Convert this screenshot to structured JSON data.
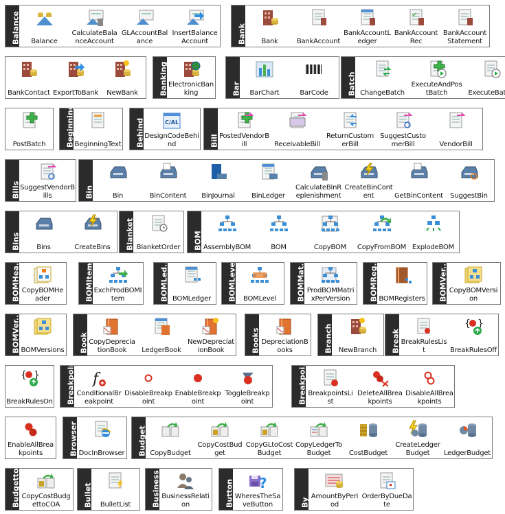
{
  "groups": [
    {
      "id": "balance",
      "header": "Balance",
      "items": [
        {
          "label": "Balance",
          "icon": "balance-scale-icon"
        },
        {
          "label": "CalculateBalanceAccount",
          "icon": "calculate-balance-icon"
        },
        {
          "label": "GLAccountBalance",
          "icon": "gl-account-balance-icon"
        },
        {
          "label": "InsertBalanceAccount",
          "icon": "insert-balance-icon"
        }
      ]
    },
    {
      "id": "bank",
      "header": "Bank",
      "items": [
        {
          "label": "Bank",
          "icon": "bank-building-icon"
        },
        {
          "label": "BankAccount",
          "icon": "bank-account-icon"
        },
        {
          "label": "BankAccountLedger",
          "icon": "bank-account-ledger-icon"
        },
        {
          "label": "BankAccountRec",
          "icon": "bank-account-rec-icon"
        },
        {
          "label": "BankAccountStatement",
          "icon": "bank-account-statement-icon"
        }
      ]
    },
    {
      "id": "bank-cont",
      "header": "",
      "items": [
        {
          "label": "BankContact",
          "icon": "bank-contact-icon"
        },
        {
          "label": "ExportToBank",
          "icon": "export-to-bank-icon"
        },
        {
          "label": "NewBank",
          "icon": "new-bank-icon"
        }
      ]
    },
    {
      "id": "banking",
      "header": "Banking",
      "items": [
        {
          "label": "ElectronicBanking",
          "icon": "electronic-banking-icon"
        }
      ]
    },
    {
      "id": "bar",
      "header": "Bar",
      "items": [
        {
          "label": "BarChart",
          "icon": "bar-chart-icon"
        },
        {
          "label": "BarCode",
          "icon": "barcode-icon"
        }
      ]
    },
    {
      "id": "batch",
      "header": "Batch",
      "items": [
        {
          "label": "ChangeBatch",
          "icon": "change-batch-icon"
        },
        {
          "label": "ExecuteAndPostBatch",
          "icon": "execute-and-post-batch-icon"
        },
        {
          "label": "ExecuteBatch",
          "icon": "execute-batch-icon"
        }
      ]
    },
    {
      "id": "batch-cont",
      "header": "",
      "items": [
        {
          "label": "PostBatch",
          "icon": "post-batch-icon"
        }
      ]
    },
    {
      "id": "beginning",
      "header": "Beginning",
      "items": [
        {
          "label": "BeginningText",
          "icon": "beginning-text-icon"
        }
      ]
    },
    {
      "id": "behind",
      "header": "Behind",
      "items": [
        {
          "label": "DesignCodeBehind",
          "icon": "cal-code-icon"
        }
      ]
    },
    {
      "id": "bill",
      "header": "Bill",
      "items": [
        {
          "label": "PostedVendorBill",
          "icon": "posted-vendor-bill-icon"
        },
        {
          "label": "ReceivableBill",
          "icon": "receivable-bill-icon"
        },
        {
          "label": "ReturnCustomerBill",
          "icon": "return-customer-bill-icon"
        },
        {
          "label": "SuggestCustomerBill",
          "icon": "suggest-customer-bill-icon"
        },
        {
          "label": "VendorBill",
          "icon": "vendor-bill-icon"
        }
      ]
    },
    {
      "id": "bills",
      "header": "Bills",
      "items": [
        {
          "label": "SuggestVendorBills",
          "icon": "suggest-vendor-bills-icon"
        }
      ]
    },
    {
      "id": "bin",
      "header": "Bin",
      "items": [
        {
          "label": "Bin",
          "icon": "bin-tray-icon"
        },
        {
          "label": "BinContent",
          "icon": "bin-content-icon"
        },
        {
          "label": "BinJournal",
          "icon": "bin-journal-icon"
        },
        {
          "label": "BinLedger",
          "icon": "bin-ledger-icon"
        },
        {
          "label": "CalculateBinReplenishment",
          "icon": "calculate-bin-replenishment-icon"
        },
        {
          "label": "CreateBinContent",
          "icon": "create-bin-content-icon"
        },
        {
          "label": "GetBinContent",
          "icon": "get-bin-content-icon"
        },
        {
          "label": "SuggestBin",
          "icon": "suggest-bin-icon"
        }
      ]
    },
    {
      "id": "bins",
      "header": "Bins",
      "items": [
        {
          "label": "Bins",
          "icon": "bins-icon"
        },
        {
          "label": "CreateBins",
          "icon": "create-bins-icon"
        }
      ]
    },
    {
      "id": "blanket",
      "header": "Blanket",
      "items": [
        {
          "label": "BlanketOrder",
          "icon": "blanket-order-icon"
        }
      ]
    },
    {
      "id": "bom",
      "header": "BOM",
      "items": [
        {
          "label": "AssemblyBOM",
          "icon": "assembly-bom-icon"
        },
        {
          "label": "BOM",
          "icon": "bom-tree-icon"
        },
        {
          "label": "CopyBOM",
          "icon": "copy-bom-icon"
        },
        {
          "label": "CopyFromBOM",
          "icon": "copy-from-bom-icon"
        },
        {
          "label": "ExplodeBOM",
          "icon": "explode-bom-icon"
        }
      ]
    },
    {
      "id": "bomheader",
      "header": "BOMHea...",
      "items": [
        {
          "label": "CopyBOMHeader",
          "icon": "copy-bom-header-icon"
        }
      ]
    },
    {
      "id": "bomitem",
      "header": "BOMItem",
      "items": [
        {
          "label": "ExchProdBOMItem",
          "icon": "exch-prod-bom-item-icon"
        }
      ]
    },
    {
      "id": "bomledger",
      "header": "BOMLed...",
      "items": [
        {
          "label": "BOMLedger",
          "icon": "bom-ledger-icon"
        }
      ]
    },
    {
      "id": "bomlevel",
      "header": "BOMLevel",
      "items": [
        {
          "label": "BOMLevel",
          "icon": "bom-level-icon"
        }
      ]
    },
    {
      "id": "bommatrix",
      "header": "BOMMat...",
      "items": [
        {
          "label": "ProdBOMMatrixPerVersion",
          "icon": "prod-bom-matrix-icon"
        }
      ]
    },
    {
      "id": "bomreg",
      "header": "BOMReg...",
      "items": [
        {
          "label": "BOMRegisters",
          "icon": "bom-registers-icon"
        }
      ]
    },
    {
      "id": "bomver1",
      "header": "BOMVer...",
      "items": [
        {
          "label": "CopyBOMVersion",
          "icon": "copy-bom-version-icon"
        }
      ]
    },
    {
      "id": "bomver2",
      "header": "BOMVer...",
      "items": [
        {
          "label": "BOMVersions",
          "icon": "bom-versions-icon"
        }
      ]
    },
    {
      "id": "book",
      "header": "Book",
      "items": [
        {
          "label": "CopyDepreciationBook",
          "icon": "copy-depreciation-book-icon"
        },
        {
          "label": "LedgerBook",
          "icon": "ledger-book-icon"
        },
        {
          "label": "NewDepreciationBook",
          "icon": "new-depreciation-book-icon"
        }
      ]
    },
    {
      "id": "books",
      "header": "Books",
      "items": [
        {
          "label": "DepreciationBooks",
          "icon": "depreciation-books-icon"
        }
      ]
    },
    {
      "id": "branch",
      "header": "Branch",
      "items": [
        {
          "label": "NewBranch",
          "icon": "new-branch-icon"
        }
      ]
    },
    {
      "id": "break",
      "header": "Break",
      "items": [
        {
          "label": "BreakRulesList",
          "icon": "break-rules-list-icon"
        },
        {
          "label": "BreakRulesOff",
          "icon": "break-rules-off-icon"
        }
      ]
    },
    {
      "id": "break-cont",
      "header": "",
      "items": [
        {
          "label": "BreakRulesOn",
          "icon": "break-rules-on-icon"
        }
      ]
    },
    {
      "id": "breakpoint",
      "header": "Breakpoint",
      "items": [
        {
          "label": "ConditionalBreakpoint",
          "icon": "conditional-breakpoint-icon"
        },
        {
          "label": "DisableBreakpoint",
          "icon": "disable-breakpoint-icon"
        },
        {
          "label": "EnableBreakpoint",
          "icon": "enable-breakpoint-icon"
        },
        {
          "label": "ToggleBreakpoint",
          "icon": "toggle-breakpoint-icon"
        }
      ]
    },
    {
      "id": "breakpoints",
      "header": "Breakpoi...",
      "items": [
        {
          "label": "BreakpointsList",
          "icon": "breakpoints-list-icon"
        },
        {
          "label": "DeleteAllBreakpoints",
          "icon": "delete-all-breakpoints-icon"
        },
        {
          "label": "DisableAllBreakpoints",
          "icon": "disable-all-breakpoints-icon"
        }
      ]
    },
    {
      "id": "breakpoints-cont",
      "header": "",
      "items": [
        {
          "label": "EnableAllBreakpoints",
          "icon": "enable-all-breakpoints-icon"
        }
      ]
    },
    {
      "id": "browser",
      "header": "Browser",
      "items": [
        {
          "label": "DocInBrowser",
          "icon": "doc-in-browser-icon"
        }
      ]
    },
    {
      "id": "budget",
      "header": "Budget",
      "items": [
        {
          "label": "CopyBudget",
          "icon": "copy-budget-icon"
        },
        {
          "label": "CopyCostBudget",
          "icon": "copy-cost-budget-icon"
        },
        {
          "label": "CopyGLtoCostBudget",
          "icon": "copy-gl-to-cost-budget-icon"
        },
        {
          "label": "CopyLedgerToBudget",
          "icon": "copy-ledger-to-budget-icon"
        },
        {
          "label": "CostBudget",
          "icon": "cost-budget-icon"
        },
        {
          "label": "CreateLedgerBudget",
          "icon": "create-ledger-budget-icon"
        },
        {
          "label": "LedgerBudget",
          "icon": "ledger-budget-icon"
        }
      ]
    },
    {
      "id": "budgetto",
      "header": "Budgetto",
      "items": [
        {
          "label": "CopyCostBudgettoCOA",
          "icon": "copy-cost-budget-to-coa-icon"
        }
      ]
    },
    {
      "id": "bullet",
      "header": "Bullet",
      "items": [
        {
          "label": "BulletList",
          "icon": "bullet-list-icon"
        }
      ]
    },
    {
      "id": "business",
      "header": "Business",
      "items": [
        {
          "label": "BusinessRelation",
          "icon": "business-relation-icon"
        }
      ]
    },
    {
      "id": "button",
      "header": "Button",
      "items": [
        {
          "label": "WheresTheSaveButton",
          "icon": "wheres-the-save-button-icon"
        }
      ]
    },
    {
      "id": "by",
      "header": "By",
      "items": [
        {
          "label": "AmountByPeriod",
          "icon": "amount-by-period-icon"
        },
        {
          "label": "OrderByDueDate",
          "icon": "order-by-due-date-icon"
        }
      ]
    }
  ]
}
